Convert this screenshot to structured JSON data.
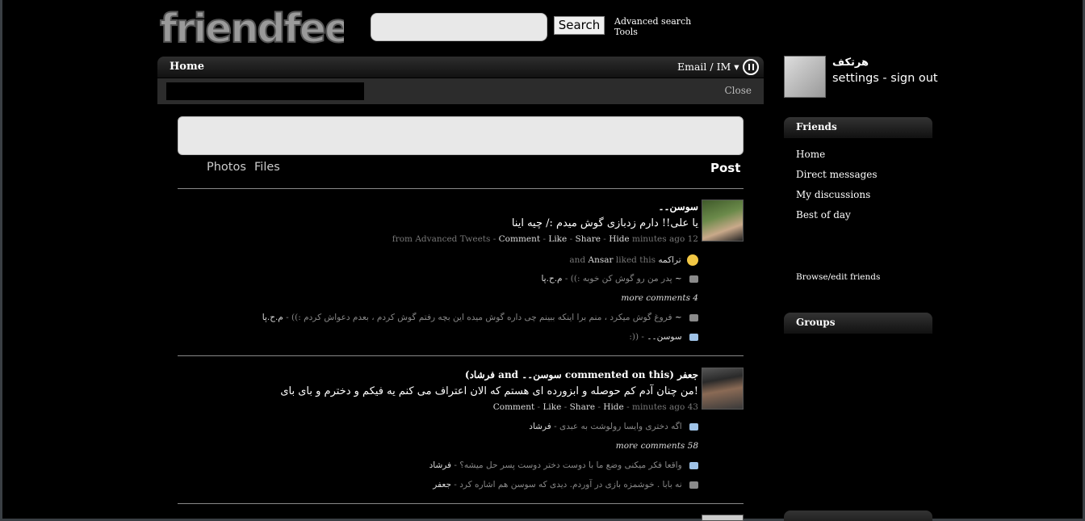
{
  "header": {
    "logo_text": "friendfeed",
    "search_placeholder": "",
    "search_button": "Search",
    "advanced_search": "Advanced search",
    "tools": "Tools"
  },
  "nav": {
    "home": "Home",
    "email_im": "Email / IM ▾",
    "close": "Close"
  },
  "composer": {
    "photos": "Photos",
    "files": "Files",
    "post": "Post"
  },
  "entries": [
    {
      "author": "سوسن۔۔",
      "body": "یا علی!! دارم زدبازی گوش میدم :/ چیه اینا",
      "meta": {
        "from": "from",
        "source": "Advanced Tweets",
        "comment": "Comment",
        "like": "Like",
        "share": "Share",
        "hide": "Hide",
        "time": "minutes ago 12"
      },
      "likes": {
        "and": "and",
        "person": "Ansar",
        "liked": "liked this",
        "first": "تراکمه"
      },
      "comments_before": [
        {
          "text": "پدر من رو گوش کن خوبه :))",
          "author": "م.ح.پا ~"
        }
      ],
      "more_comments": "more comments 4",
      "comments_after": [
        {
          "text": "فروغ گوش میکرد ، منم برا اینکه ببینم چی داره گوش میده این بچه رفتم گوش کردم ، بعدم دعواش کردم :))",
          "author": "م.ح.پا ~"
        },
        {
          "text": ":))",
          "author": "سوسن۔۔"
        }
      ]
    },
    {
      "author": "جعفر",
      "commented": "(فرشاد and سوسن۔۔ commented on this)",
      "body": "من چنان آدم کم حوصله و ابزورده ای هستم که الان اعتراف می کنم یه فیکم و دخترم و بای بای!",
      "meta": {
        "comment": "Comment",
        "like": "Like",
        "share": "Share",
        "hide": "Hide",
        "time": "minutes ago 43"
      },
      "comments_before": [
        {
          "text": "اگه دختری وایسا رولوشت به عبدی",
          "author": "فرشاد"
        }
      ],
      "more_comments": "more comments 58",
      "comments_after": [
        {
          "text": "واقعا فکر میکنی وضع ما با دوست دختر دوست پسر حل میشه؟",
          "author": "فرشاد"
        },
        {
          "text": "نه بابا . خوشمزه بازی در آوردم. دیدی که سوسن هم اشاره کرد",
          "author": "جعفر"
        }
      ]
    }
  ],
  "me": {
    "name": "هرتکف",
    "settings": "settings",
    "signout": "sign out"
  },
  "friends": {
    "title": "Friends",
    "links": [
      "Home",
      "Direct messages",
      "My discussions",
      "Best of day"
    ],
    "browse": "Browse/edit friends"
  },
  "groups": {
    "title": "Groups"
  },
  "colors": {
    "background": "#000000",
    "bar": "#2c2c2c",
    "input": "#e8e8e8",
    "smile": "#f2c744"
  }
}
